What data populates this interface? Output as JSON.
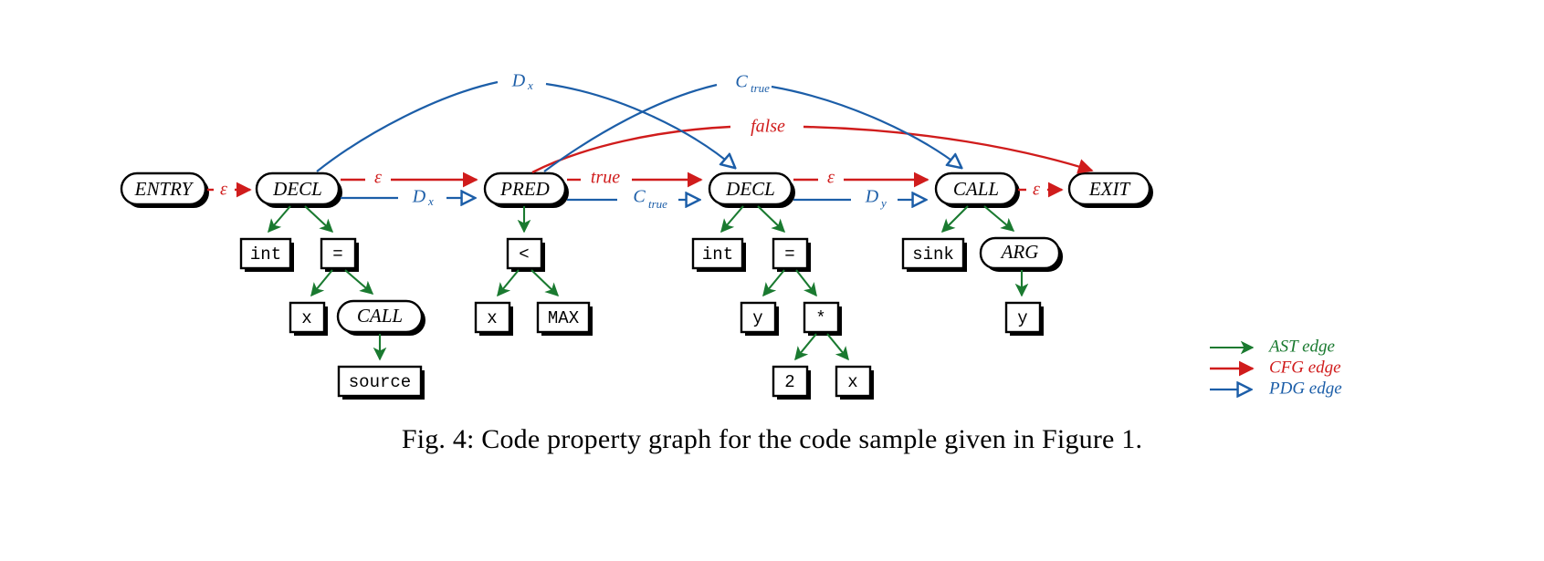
{
  "figure": {
    "caption": "Fig. 4: Code property graph for the code sample given in Figure 1.",
    "colors": {
      "ast": "#1a7a30",
      "cfg": "#d01c1c",
      "pdg": "#1c5ea8",
      "node_stroke": "#000000",
      "background": "#ffffff"
    }
  },
  "legend": {
    "items": [
      {
        "label": "AST edge",
        "color": "#1a7a30",
        "arrow": "filled"
      },
      {
        "label": "CFG edge",
        "color": "#d01c1c",
        "arrow": "filled"
      },
      {
        "label": "PDG edge",
        "color": "#1c5ea8",
        "arrow": "hollow"
      }
    ]
  },
  "nodes": {
    "entry": {
      "label": "ENTRY",
      "shape": "rounded",
      "style": "italic"
    },
    "decl1": {
      "label": "DECL",
      "shape": "rounded",
      "style": "italic"
    },
    "pred": {
      "label": "PRED",
      "shape": "rounded",
      "style": "italic"
    },
    "decl2": {
      "label": "DECL",
      "shape": "rounded",
      "style": "italic"
    },
    "call_main": {
      "label": "CALL",
      "shape": "rounded",
      "style": "italic"
    },
    "exit": {
      "label": "EXIT",
      "shape": "rounded",
      "style": "italic"
    },
    "int1": {
      "label": "int",
      "shape": "rect",
      "style": "mono"
    },
    "assign1": {
      "label": "=",
      "shape": "rect",
      "style": "mono"
    },
    "x1": {
      "label": "x",
      "shape": "rect",
      "style": "mono"
    },
    "call_src": {
      "label": "CALL",
      "shape": "rounded",
      "style": "italic"
    },
    "source": {
      "label": "source",
      "shape": "rect",
      "style": "mono"
    },
    "lt": {
      "label": "<",
      "shape": "rect",
      "style": "mono"
    },
    "x2": {
      "label": "x",
      "shape": "rect",
      "style": "mono"
    },
    "max": {
      "label": "MAX",
      "shape": "rect",
      "style": "mono"
    },
    "int2": {
      "label": "int",
      "shape": "rect",
      "style": "mono"
    },
    "assign2": {
      "label": "=",
      "shape": "rect",
      "style": "mono"
    },
    "y1": {
      "label": "y",
      "shape": "rect",
      "style": "mono"
    },
    "mul": {
      "label": "*",
      "shape": "rect",
      "style": "mono"
    },
    "two": {
      "label": "2",
      "shape": "rect",
      "style": "mono"
    },
    "x3": {
      "label": "x",
      "shape": "rect",
      "style": "mono"
    },
    "sink": {
      "label": "sink",
      "shape": "rect",
      "style": "mono"
    },
    "arg": {
      "label": "ARG",
      "shape": "rounded",
      "style": "italic"
    },
    "y2": {
      "label": "y",
      "shape": "rect",
      "style": "mono"
    }
  },
  "edge_labels": {
    "cfg_entry_decl1": "ε",
    "cfg_decl1_pred": "ε",
    "cfg_pred_decl2": "true",
    "cfg_decl2_call": "ε",
    "cfg_call_exit": "ε",
    "cfg_pred_exit_false": "false",
    "pdg_decl1_pred_base": "D",
    "pdg_decl1_pred_sub": "x",
    "pdg_pred_decl2_base": "C",
    "pdg_pred_decl2_sub": "true",
    "pdg_decl2_call_base": "D",
    "pdg_decl2_call_sub": "y",
    "pdg_decl1_call_base": "D",
    "pdg_decl1_call_sub": "x",
    "pdg_pred_call_base": "C",
    "pdg_pred_call_sub": "true"
  }
}
